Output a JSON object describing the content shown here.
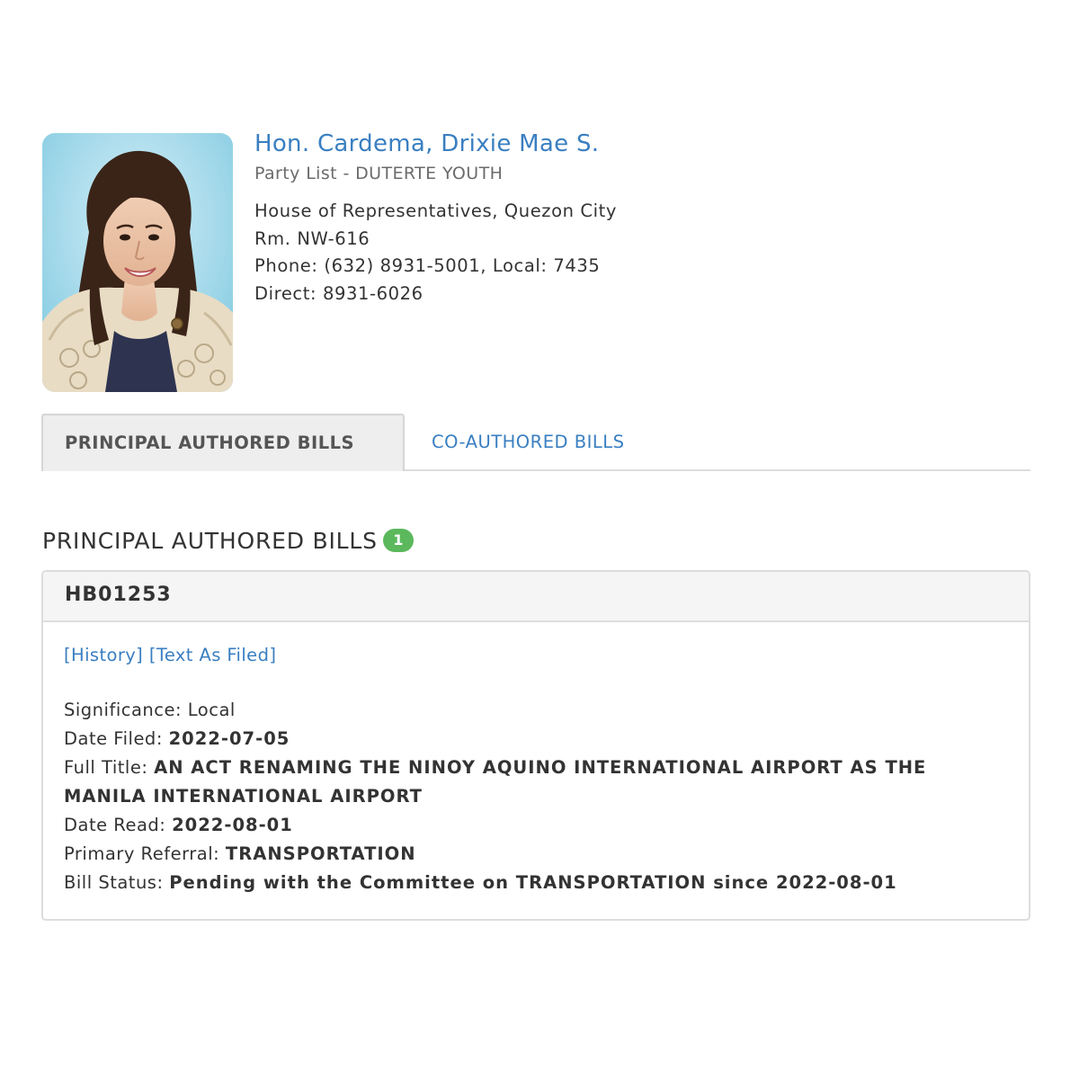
{
  "profile": {
    "name": "Hon. Cardema, Drixie Mae S.",
    "party": "Party List - DUTERTE YOUTH",
    "address": "House of Representatives, Quezon City",
    "room": "Rm. NW-616",
    "phone": "Phone: (632) 8931-5001, Local: 7435",
    "direct": "Direct: 8931-6026"
  },
  "tabs": {
    "principal": "PRINCIPAL AUTHORED BILLS",
    "coauthored": "CO-AUTHORED BILLS"
  },
  "section": {
    "title": "PRINCIPAL AUTHORED BILLS",
    "count": "1"
  },
  "bill": {
    "number": "HB01253",
    "history_link": "[History]",
    "text_link": "[Text As Filed]",
    "significance_label": "Significance:",
    "significance": "Local",
    "date_filed_label": "Date Filed:",
    "date_filed": "2022-07-05",
    "full_title_label": "Full Title:",
    "full_title": "AN ACT RENAMING THE NINOY AQUINO INTERNATIONAL AIRPORT AS THE MANILA INTERNATIONAL AIRPORT",
    "date_read_label": "Date Read:",
    "date_read": "2022-08-01",
    "referral_label": "Primary Referral:",
    "referral": "TRANSPORTATION",
    "status_label": "Bill Status:",
    "status": "Pending with the Committee on TRANSPORTATION since 2022-08-01"
  },
  "colors": {
    "link": "#3a7fc1",
    "badge": "#5cb85c",
    "photo_background": "#9fd6e8"
  },
  "icons": {
    "photo": "member-portrait"
  }
}
